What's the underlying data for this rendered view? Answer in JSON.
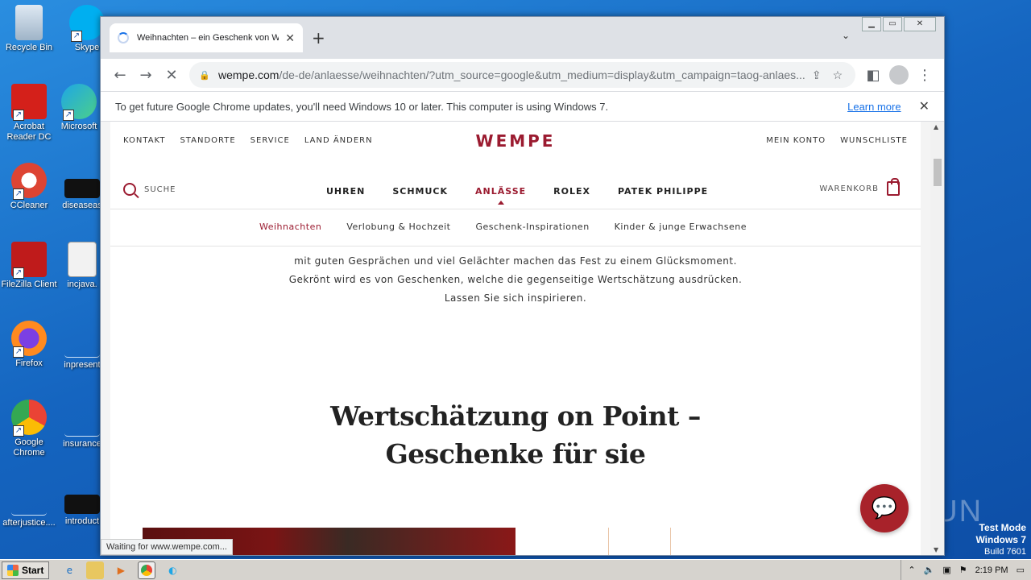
{
  "desktop": {
    "icons": [
      {
        "label": "Recycle Bin"
      },
      {
        "label": "Skype"
      },
      {
        "label": "Acrobat Reader DC"
      },
      {
        "label": "Microsoft"
      },
      {
        "label": "CCleaner"
      },
      {
        "label": "diseaseas"
      },
      {
        "label": "FileZilla Client"
      },
      {
        "label": "incjava."
      },
      {
        "label": "Firefox"
      },
      {
        "label": "inpresent"
      },
      {
        "label": "Google Chrome"
      },
      {
        "label": "insurance"
      },
      {
        "label": "afterjustice...."
      },
      {
        "label": "introduct"
      }
    ],
    "watermark": "ANY.RUN",
    "testmode": {
      "line1": "Test Mode",
      "line2": "Windows 7",
      "line3": "Build 7601"
    }
  },
  "browser": {
    "tab_title": "Weihnachten – ein Geschenk von Wempe",
    "url_host": "wempe.com",
    "url_path": "/de-de/anlaesse/weihnachten/?utm_source=google&utm_medium=display&utm_campaign=taog-anlaes...",
    "infobar_message": "To get future Google Chrome updates, you'll need Windows 10 or later. This computer is using Windows 7.",
    "infobar_link": "Learn more",
    "status_text": "Waiting for www.wempe.com..."
  },
  "site": {
    "top_left_nav": [
      "KONTAKT",
      "STANDORTE",
      "SERVICE",
      "LAND ÄNDERN"
    ],
    "logo": "WEMPE",
    "top_right_nav": [
      "MEIN KONTO",
      "WUNSCHLISTE"
    ],
    "search_label": "SUCHE",
    "main_nav": [
      "UHREN",
      "SCHMUCK",
      "ANLÄSSE",
      "ROLEX",
      "PATEK PHILIPPE"
    ],
    "cart_label": "WARENKORB",
    "sub_nav": [
      "Weihnachten",
      "Verlobung & Hochzeit",
      "Geschenk-Inspirationen",
      "Kinder & junge Erwachsene"
    ],
    "intro_lines": [
      "mit guten Gesprächen und viel Gelächter machen das Fest zu einem Glücksmoment.",
      "Gekrönt wird es von Geschenken, welche die gegenseitige Wertschätzung ausdrücken.",
      "Lassen Sie sich inspirieren."
    ],
    "heading": "Wertschätzung on Point – Geschenke für sie",
    "accent_color": "#9b1b30"
  },
  "taskbar": {
    "start_label": "Start",
    "clock": "2:19 PM"
  }
}
